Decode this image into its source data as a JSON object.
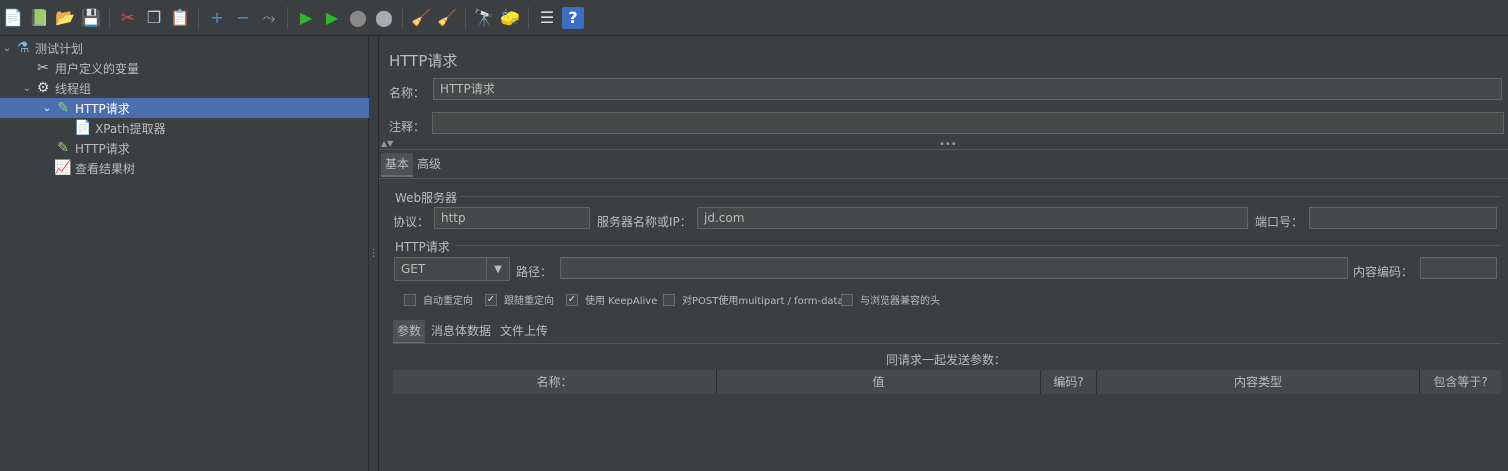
{
  "toolbar": {
    "buttons": [
      {
        "name": "new-icon",
        "glyph": "📄",
        "color": "#eeeeee"
      },
      {
        "name": "templates-icon",
        "glyph": "📗",
        "color": "#6fbf4f"
      },
      {
        "name": "open-icon",
        "glyph": "📂",
        "color": "#e8c15a"
      },
      {
        "name": "save-icon",
        "glyph": "💾",
        "color": "#cfcfcf"
      },
      {
        "name": "sep"
      },
      {
        "name": "cut-icon",
        "glyph": "✂",
        "color": "#e05050"
      },
      {
        "name": "copy-icon",
        "glyph": "❐",
        "color": "#cccccc"
      },
      {
        "name": "paste-icon",
        "glyph": "📋",
        "color": "#e0b050"
      },
      {
        "name": "sep"
      },
      {
        "name": "expand-icon",
        "glyph": "+",
        "color": "#4a90e2"
      },
      {
        "name": "collapse-icon",
        "glyph": "−",
        "color": "#4a90e2"
      },
      {
        "name": "toggle-icon",
        "glyph": "⤳",
        "color": "#9aa0a6"
      },
      {
        "name": "sep"
      },
      {
        "name": "start-icon",
        "glyph": "▶",
        "color": "#2eb82e"
      },
      {
        "name": "start-no-pause-icon",
        "glyph": "▶",
        "color": "#2eb82e"
      },
      {
        "name": "stop-icon",
        "glyph": "⬤",
        "color": "#888888"
      },
      {
        "name": "shutdown-icon",
        "glyph": "⬤",
        "color": "#aaaaaa"
      },
      {
        "name": "sep"
      },
      {
        "name": "clear-icon",
        "glyph": "🧹",
        "color": "#d0a060"
      },
      {
        "name": "clear-all-icon",
        "glyph": "🧹",
        "color": "#d0a060"
      },
      {
        "name": "sep"
      },
      {
        "name": "search-icon",
        "glyph": "🔭",
        "color": "#cccccc"
      },
      {
        "name": "reset-search-icon",
        "glyph": "🧽",
        "color": "#e8c15a"
      },
      {
        "name": "sep"
      },
      {
        "name": "function-helper-icon",
        "glyph": "☰",
        "color": "#dddddd"
      },
      {
        "name": "help-icon",
        "glyph": "?",
        "color": "#ffffff"
      }
    ]
  },
  "tree": {
    "items": [
      {
        "label": "测试计划",
        "icon": "⚗",
        "depth": 0,
        "expanded": true,
        "selected": false,
        "icon_name": "test-plan-icon",
        "icon_color": "#7fb3e0"
      },
      {
        "label": "用户定义的变量",
        "icon": "✂",
        "depth": 1,
        "expanded": null,
        "selected": false,
        "icon_name": "variables-icon",
        "icon_color": "#cccccc"
      },
      {
        "label": "线程组",
        "icon": "⚙",
        "depth": 1,
        "expanded": true,
        "selected": false,
        "icon_name": "thread-group-icon",
        "icon_color": "#dddddd"
      },
      {
        "label": "HTTP请求",
        "icon": "✎",
        "depth": 2,
        "expanded": true,
        "selected": true,
        "icon_name": "http-sampler-icon",
        "icon_color": "#9fd06f"
      },
      {
        "label": "XPath提取器",
        "icon": "📄",
        "depth": 3,
        "expanded": null,
        "selected": false,
        "icon_name": "xpath-extractor-icon",
        "icon_color": "#ffffff"
      },
      {
        "label": "HTTP请求",
        "icon": "✎",
        "depth": 2,
        "expanded": null,
        "selected": false,
        "icon_name": "http-sampler-icon",
        "icon_color": "#9fd06f"
      },
      {
        "label": "查看结果树",
        "icon": "📈",
        "depth": 2,
        "expanded": null,
        "selected": false,
        "icon_name": "results-tree-icon",
        "icon_color": "#d080c0"
      }
    ]
  },
  "panel": {
    "title": "HTTP请求",
    "name_label": "名称：",
    "name_value": "HTTP请求",
    "comment_label": "注释：",
    "comment_value": "",
    "tabs": [
      "基本",
      "高级"
    ],
    "web_server_group": "Web服务器",
    "protocol_label": "协议：",
    "protocol_value": "http",
    "server_label": "服务器名称或IP：",
    "server_value": "jd.com",
    "port_label": "端口号：",
    "port_value": "",
    "http_request_group": "HTTP请求",
    "method_value": "GET",
    "path_label": "路径：",
    "path_value": "",
    "encoding_label": "内容编码：",
    "encoding_value": "",
    "checkboxes": [
      {
        "label": "自动重定向",
        "checked": false
      },
      {
        "label": "跟随重定向",
        "checked": true
      },
      {
        "label": "使用 KeepAlive",
        "checked": true
      },
      {
        "label": "对POST使用multipart / form-data",
        "checked": false
      },
      {
        "label": "与浏览器兼容的头",
        "checked": false
      }
    ],
    "sub_tabs": [
      "参数",
      "消息体数据",
      "文件上传"
    ],
    "params_caption": "同请求一起发送参数：",
    "table_headers": [
      "名称：",
      "值",
      "编码?",
      "内容类型",
      "包含等于?"
    ]
  }
}
